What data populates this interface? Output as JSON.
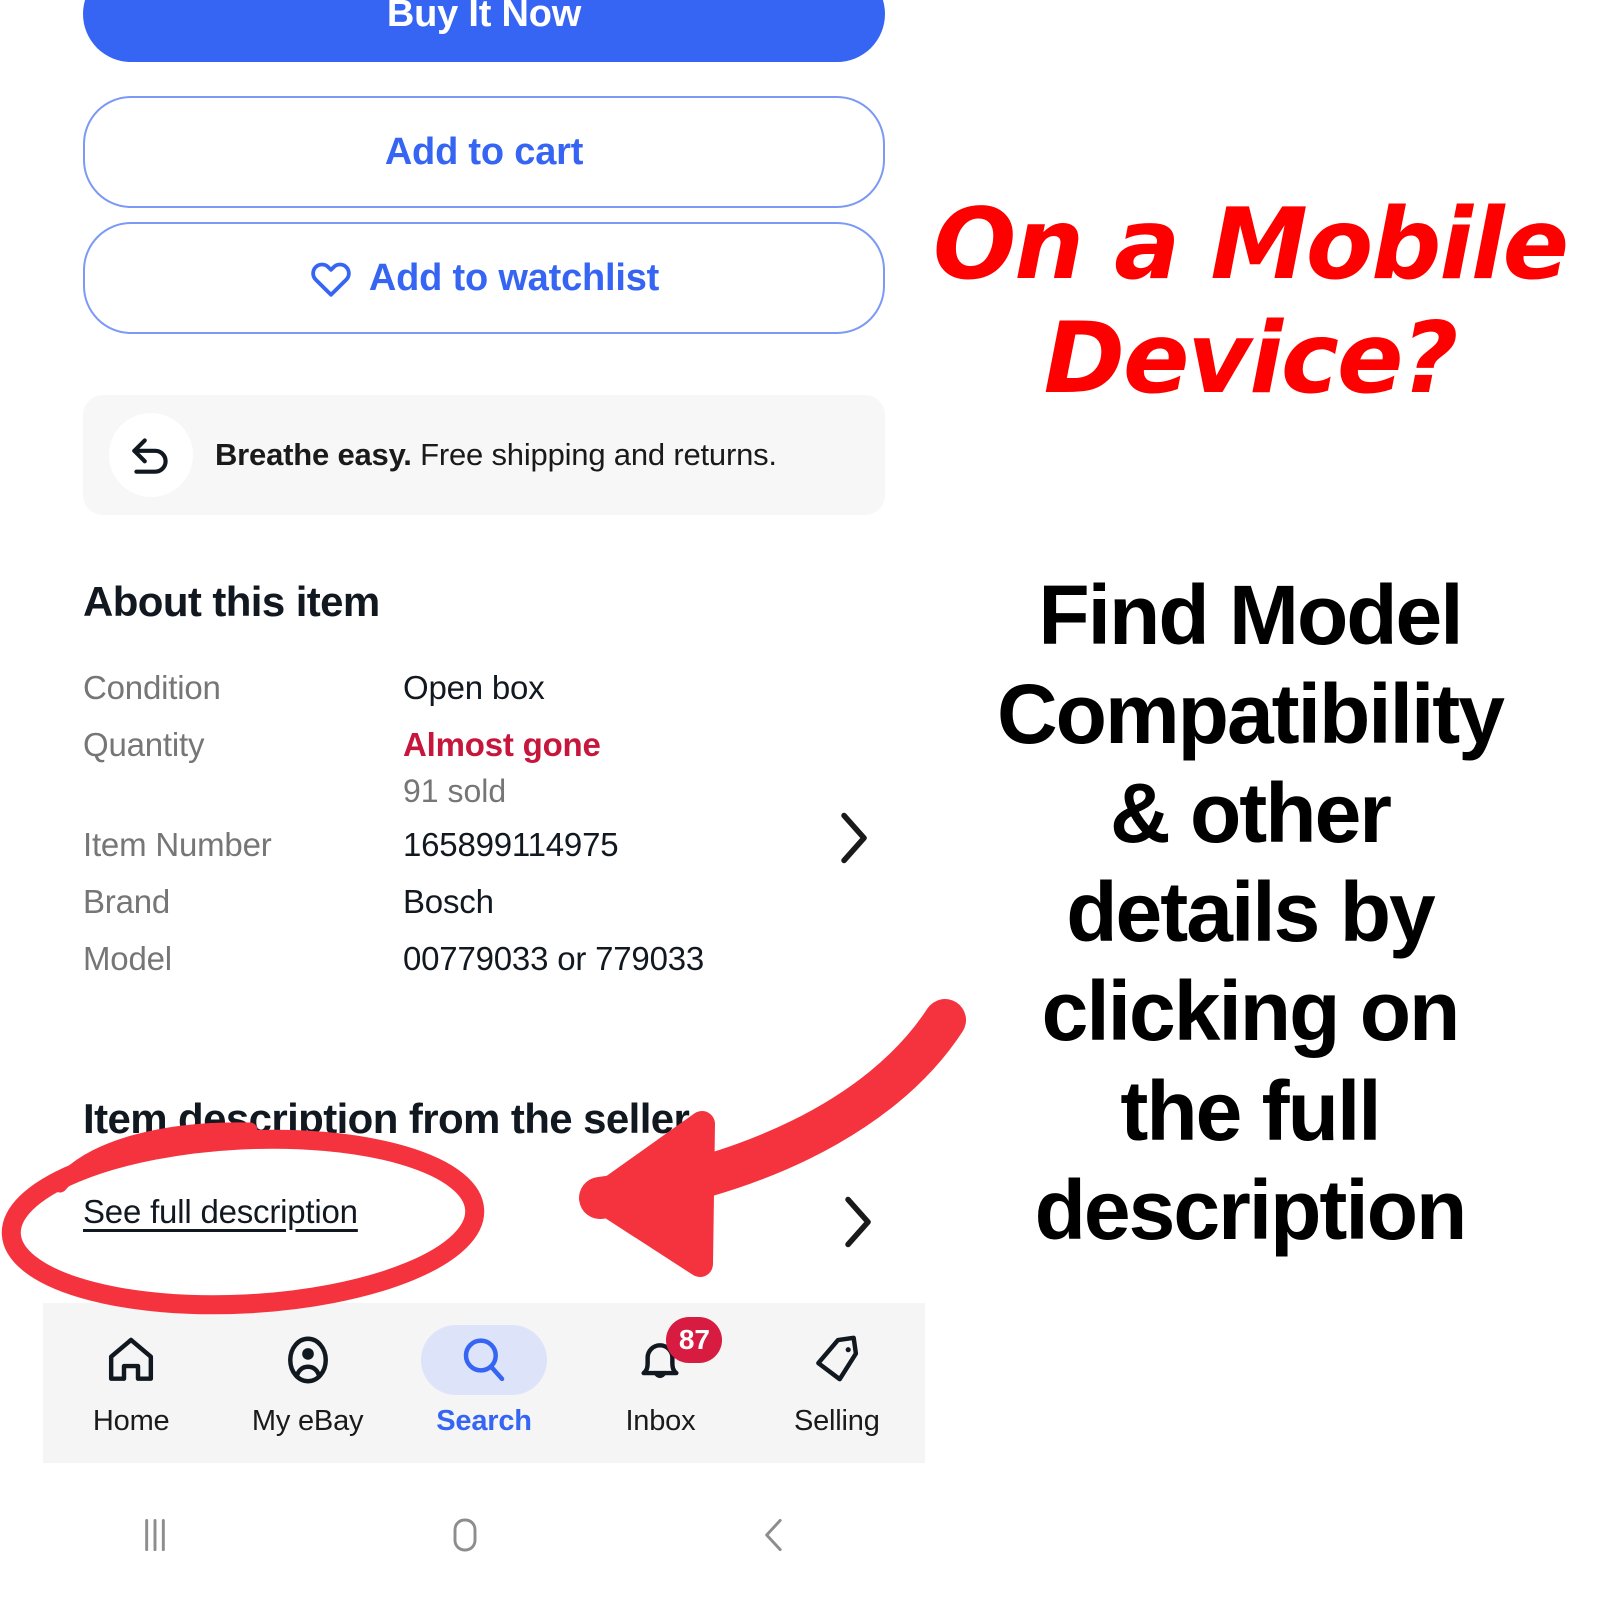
{
  "actions": {
    "buy_now": "Buy It Now",
    "add_to_cart": "Add to cart",
    "add_to_watchlist": "Add to watchlist"
  },
  "banner": {
    "icon": "return-arrow-icon",
    "bold_text": "Breathe easy.",
    "text": " Free shipping and returns."
  },
  "about": {
    "title": "About this item",
    "rows": [
      {
        "label": "Condition",
        "value": "Open box",
        "sub": ""
      },
      {
        "label": "Quantity",
        "value": "Almost gone",
        "sub": "91 sold",
        "alert": true
      },
      {
        "label": "Item Number",
        "value": "165899114975",
        "sub": ""
      },
      {
        "label": "Brand",
        "value": "Bosch",
        "sub": ""
      },
      {
        "label": "Model",
        "value": "00779033 or 779033",
        "sub": ""
      }
    ]
  },
  "description": {
    "title": "Item description from the seller",
    "link": "See full description"
  },
  "bottom_nav": {
    "items": [
      {
        "label": "Home",
        "icon": "home-icon",
        "active": false,
        "badge": ""
      },
      {
        "label": "My eBay",
        "icon": "account-circle-icon",
        "active": false,
        "badge": ""
      },
      {
        "label": "Search",
        "icon": "search-icon",
        "active": true,
        "badge": ""
      },
      {
        "label": "Inbox",
        "icon": "bell-icon",
        "active": false,
        "badge": "87"
      },
      {
        "label": "Selling",
        "icon": "tag-icon",
        "active": false,
        "badge": ""
      }
    ]
  },
  "system_nav": {
    "recent": "recent-apps-icon",
    "home": "home-button-icon",
    "back": "back-button-icon"
  },
  "annotation": {
    "headline_lines": [
      "On a Mobile",
      "Device?"
    ],
    "body_lines": [
      "Find  Model",
      "Compatibility",
      "& other",
      "details by",
      "clicking on",
      "the full",
      "description"
    ],
    "marker_color": "#F5333F",
    "headline_color": "#FF0000"
  }
}
